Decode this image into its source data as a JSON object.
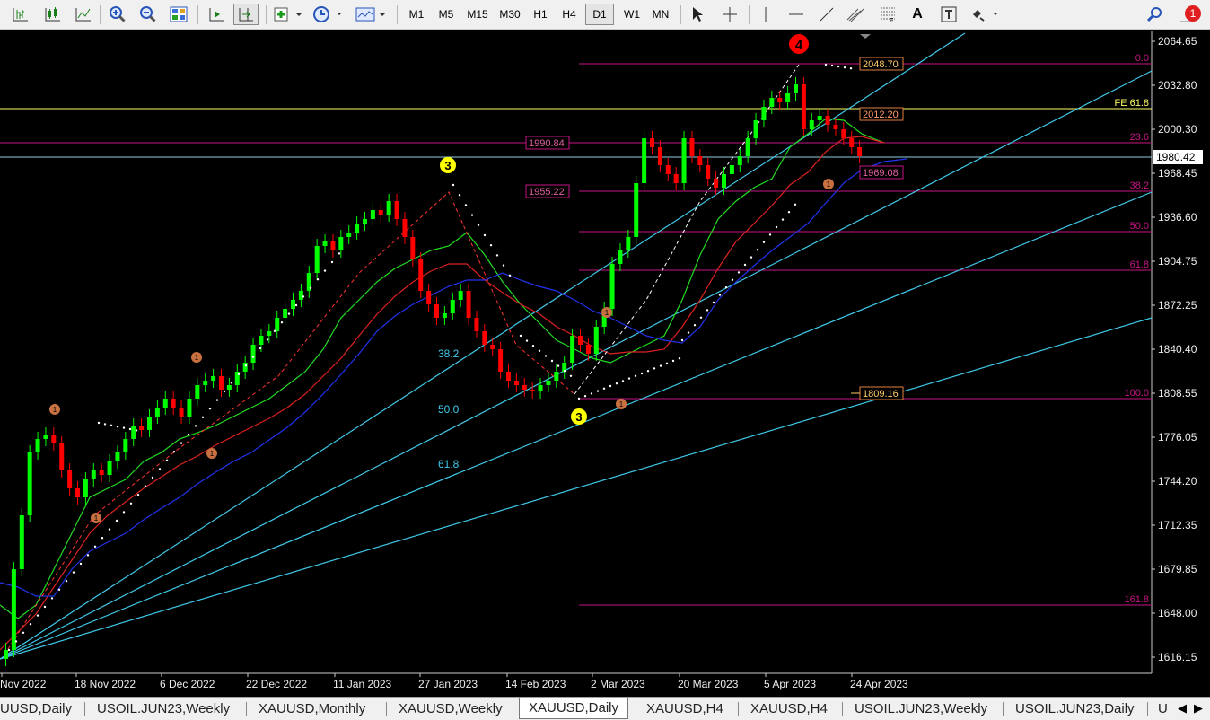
{
  "toolbar": {
    "timeframes": [
      "M1",
      "M5",
      "M15",
      "M30",
      "H1",
      "H4",
      "D1",
      "W1",
      "MN"
    ],
    "active_timeframe": "D1",
    "text_tool_label": "A",
    "notification_count": "1"
  },
  "chart": {
    "price_labels": [
      "2064.65",
      "2032.80",
      "2000.30",
      "1968.45",
      "1936.60",
      "1904.75",
      "1872.25",
      "1840.40",
      "1808.55",
      "1776.05",
      "1744.20",
      "1712.35",
      "1679.85",
      "1648.00",
      "1616.15"
    ],
    "current_price": "1980.42",
    "date_labels": [
      "Nov 2022",
      "18 Nov 2022",
      "6 Dec 2022",
      "22 Dec 2022",
      "11 Jan 2023",
      "27 Jan 2023",
      "14 Feb 2023",
      "2 Mar 2023",
      "20 Mar 2023",
      "5 Apr 2023",
      "24 Apr 2023"
    ],
    "fib_right_levels": [
      "0.0",
      "23.6",
      "38.2",
      "50.0",
      "61.8",
      "100.0",
      "161.8"
    ],
    "fe_label": "FE 61.8",
    "fan_levels": [
      "38.2",
      "50.0",
      "61.8"
    ],
    "price_tags_left": [
      "1990.84",
      "1955.22"
    ],
    "price_tags_right": [
      "2048.70",
      "2012.20",
      "1969.08",
      "1809.16"
    ],
    "wave_labels": {
      "wave3_top": "3",
      "wave3_bottom": "3",
      "wave4": "4"
    },
    "minor_marker": "1",
    "colors": {
      "bull_candle": "#00ff00",
      "bear_candle": "#ff0000",
      "fib_line": "#c71585",
      "trend_line": "#40c8e8",
      "fe_line": "#ffff66",
      "ma_fast": "#22dd22",
      "ma_mid": "#dd2222",
      "ma_slow": "#2233ee",
      "wave_label_yellow": "#ffff00",
      "wave_label_red": "#ff0000",
      "marker_orange": "#c87040"
    }
  },
  "tabs": {
    "items": [
      "UUSD,Daily",
      "USOIL.JUN23,Weekly",
      "XAUUSD,Monthly",
      "XAUUSD,Weekly",
      "XAUUSD,Daily",
      "XAUUSD,H4",
      "XAUUSD,H4",
      "USOIL.JUN23,Weekly",
      "USOIL.JUN23,Daily",
      "U"
    ],
    "active": "XAUUSD,Daily"
  }
}
